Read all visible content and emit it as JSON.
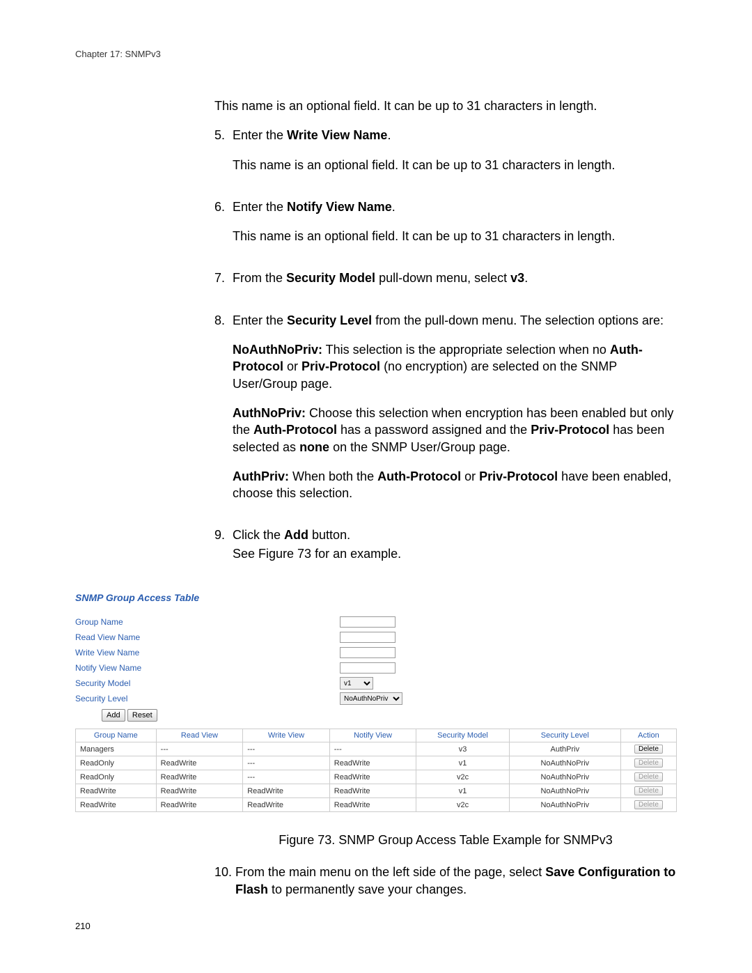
{
  "header": {
    "chapter": "Chapter 17: SNMPv3"
  },
  "body": {
    "p0": "This name is an optional field. It can be up to 31 characters in length.",
    "s5": {
      "num": "5.",
      "t1a": "Enter the ",
      "t1b": "Write View Name",
      "t1c": ".",
      "p": "This name is an optional field. It can be up to 31 characters in length."
    },
    "s6": {
      "num": "6.",
      "t1a": "Enter the ",
      "t1b": "Notify View Name",
      "t1c": ".",
      "p": "This name is an optional field. It can be up to 31 characters in length."
    },
    "s7": {
      "num": "7.",
      "t1a": "From the ",
      "t1b": "Security Model",
      "t1c": " pull-down menu, select ",
      "t1d": "v3",
      "t1e": "."
    },
    "s8": {
      "num": "8.",
      "t1a": "Enter the ",
      "t1b": "Security Level",
      "t1c": " from the pull-down menu. The selection options are:",
      "noauth": {
        "b": "NoAuthNoPriv:",
        "t1": " This selection is the appropriate selection when no ",
        "b2": "Auth-Protocol",
        "t2": " or ",
        "b3": "Priv-Protocol",
        "t3": " (no encryption) are selected on the SNMP User/Group page."
      },
      "authnp": {
        "b": "AuthNoPriv:",
        "t1": " Choose this selection when encryption has been enabled but only the ",
        "b2": "Auth-Protocol",
        "t2": " has a password assigned and the ",
        "b3": "Priv-Protocol",
        "t3": " has been selected as ",
        "b4": "none",
        "t4": " on the SNMP User/Group page."
      },
      "authp": {
        "b": "AuthPriv:",
        "t1": " When both the ",
        "b2": "Auth-Protocol",
        "t2": " or ",
        "b3": "Priv-Protocol",
        "t3": " have been enabled, choose this selection."
      }
    },
    "s9": {
      "num": "9.",
      "t1a": "Click the ",
      "t1b": "Add",
      "t1c": " button.",
      "p": "See Figure 73 for an example."
    },
    "s10": {
      "num": "10.",
      "t1a": "From the main menu on the left side of the page, select ",
      "b1": "Save Configuration to Flash",
      "t2": " to permanently save your changes."
    }
  },
  "figure": {
    "title": "SNMP Group Access Table",
    "form": {
      "group_name": "Group Name",
      "read_view_name": "Read View Name",
      "write_view_name": "Write View Name",
      "notify_view_name": "Notify View Name",
      "security_model": "Security Model",
      "security_level": "Security Level",
      "sm_value": "v1",
      "sl_value": "NoAuthNoPriv",
      "add": "Add",
      "reset": "Reset"
    },
    "headers": {
      "gn": "Group Name",
      "rv": "Read View",
      "wv": "Write View",
      "nv": "Notify View",
      "sm": "Security Model",
      "sl": "Security Level",
      "ac": "Action"
    },
    "rows": [
      {
        "gn": "Managers",
        "rv": "---",
        "wv": "---",
        "nv": "---",
        "sm": "v3",
        "sl": "AuthPriv",
        "del": "Delete",
        "disabled": false
      },
      {
        "gn": "ReadOnly",
        "rv": "ReadWrite",
        "wv": "---",
        "nv": "ReadWrite",
        "sm": "v1",
        "sl": "NoAuthNoPriv",
        "del": "Delete",
        "disabled": true
      },
      {
        "gn": "ReadOnly",
        "rv": "ReadWrite",
        "wv": "---",
        "nv": "ReadWrite",
        "sm": "v2c",
        "sl": "NoAuthNoPriv",
        "del": "Delete",
        "disabled": true
      },
      {
        "gn": "ReadWrite",
        "rv": "ReadWrite",
        "wv": "ReadWrite",
        "nv": "ReadWrite",
        "sm": "v1",
        "sl": "NoAuthNoPriv",
        "del": "Delete",
        "disabled": true
      },
      {
        "gn": "ReadWrite",
        "rv": "ReadWrite",
        "wv": "ReadWrite",
        "nv": "ReadWrite",
        "sm": "v2c",
        "sl": "NoAuthNoPriv",
        "del": "Delete",
        "disabled": true
      }
    ],
    "caption": "Figure 73. SNMP Group Access Table Example for SNMPv3"
  },
  "page_number": "210"
}
